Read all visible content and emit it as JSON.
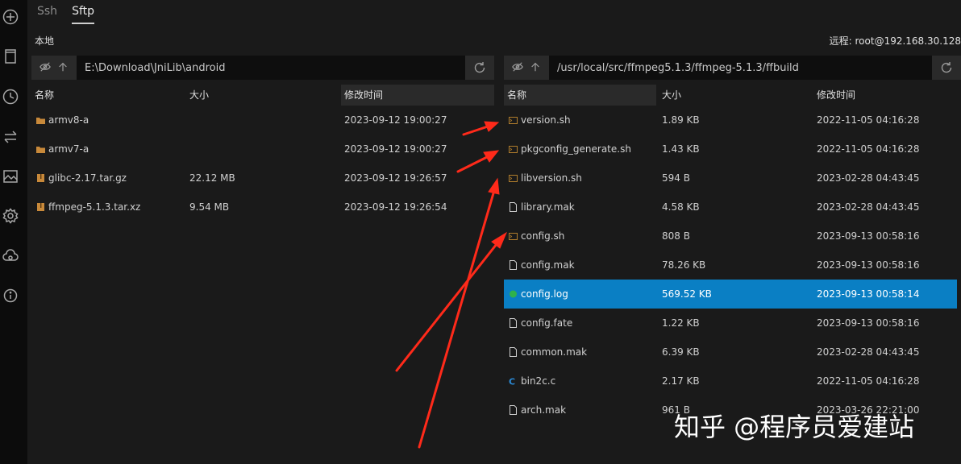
{
  "tabs": [
    {
      "label": "Ssh"
    },
    {
      "label": "Sftp"
    }
  ],
  "local": {
    "label": "本地",
    "path": "E:\\Download\\JniLib\\android",
    "columns": [
      "名称",
      "大小",
      "修改时间"
    ],
    "rows": [
      {
        "name": "armv8-a",
        "size": "",
        "mtime": "2023-09-12 19:00:27",
        "icon": "folder-icon"
      },
      {
        "name": "armv7-a",
        "size": "",
        "mtime": "2023-09-12 19:00:27",
        "icon": "folder-icon"
      },
      {
        "name": "glibc-2.17.tar.gz",
        "size": "22.12 MB",
        "mtime": "2023-09-12 19:26:57",
        "icon": "archive-icon"
      },
      {
        "name": "ffmpeg-5.1.3.tar.xz",
        "size": "9.54 MB",
        "mtime": "2023-09-12 19:26:54",
        "icon": "archive-icon"
      }
    ]
  },
  "remote": {
    "label": "远程: root@192.168.30.128",
    "path": "/usr/local/src/ffmpeg5.1.3/ffmpeg-5.1.3/ffbuild",
    "columns": [
      "名称",
      "大小",
      "修改时间"
    ],
    "rows": [
      {
        "name": "version.sh",
        "size": "1.89 KB",
        "mtime": "2022-11-05 04:16:28",
        "icon": "script-icon"
      },
      {
        "name": "pkgconfig_generate.sh",
        "size": "1.43 KB",
        "mtime": "2022-11-05 04:16:28",
        "icon": "script-icon"
      },
      {
        "name": "libversion.sh",
        "size": "594 B",
        "mtime": "2023-02-28 04:43:45",
        "icon": "script-icon"
      },
      {
        "name": "library.mak",
        "size": "4.58 KB",
        "mtime": "2023-02-28 04:43:45",
        "icon": "file-icon"
      },
      {
        "name": "config.sh",
        "size": "808 B",
        "mtime": "2023-09-13 00:58:16",
        "icon": "script-icon"
      },
      {
        "name": "config.mak",
        "size": "78.26 KB",
        "mtime": "2023-09-13 00:58:16",
        "icon": "file-icon"
      },
      {
        "name": "config.log",
        "size": "569.52 KB",
        "mtime": "2023-09-13 00:58:14",
        "icon": "log-icon",
        "selected": true
      },
      {
        "name": "config.fate",
        "size": "1.22 KB",
        "mtime": "2023-09-13 00:58:16",
        "icon": "file-icon"
      },
      {
        "name": "common.mak",
        "size": "6.39 KB",
        "mtime": "2023-02-28 04:43:45",
        "icon": "file-icon"
      },
      {
        "name": "bin2c.c",
        "size": "2.17 KB",
        "mtime": "2022-11-05 04:16:28",
        "icon": "c-file-icon"
      },
      {
        "name": "arch.mak",
        "size": "961 B",
        "mtime": "2023-03-26 22:21:00",
        "icon": "file-icon"
      }
    ]
  },
  "watermark": "知乎 @程序员爱建站",
  "colors": {
    "selection": "#0a7fc4",
    "folder": "#c8893a",
    "script": "#b07d2c",
    "arrow": "#ff2a1a"
  }
}
